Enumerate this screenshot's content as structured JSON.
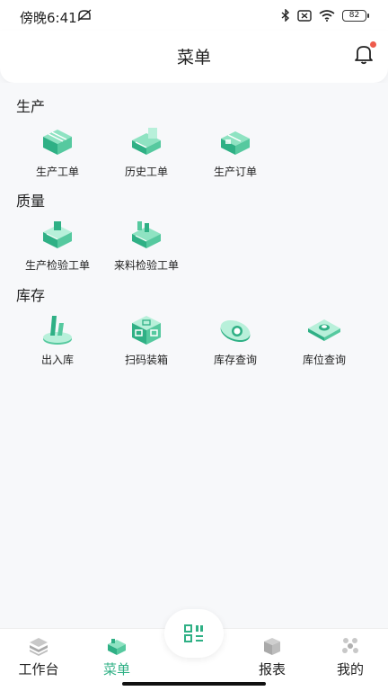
{
  "status": {
    "time": "傍晚6:41",
    "battery": "82"
  },
  "header": {
    "title": "菜单"
  },
  "sections": {
    "production": {
      "title": "生产",
      "items": [
        {
          "label": "生产工单",
          "icon": "production-order-icon"
        },
        {
          "label": "历史工单",
          "icon": "history-order-icon"
        },
        {
          "label": "生产订单",
          "icon": "production-plan-icon"
        }
      ]
    },
    "quality": {
      "title": "质量",
      "items": [
        {
          "label": "生产检验工单",
          "icon": "production-inspection-icon"
        },
        {
          "label": "来料检验工单",
          "icon": "incoming-inspection-icon"
        }
      ]
    },
    "inventory": {
      "title": "库存",
      "items": [
        {
          "label": "出入库",
          "icon": "in-out-stock-icon"
        },
        {
          "label": "扫码装箱",
          "icon": "scan-packing-icon"
        },
        {
          "label": "库存查询",
          "icon": "stock-query-icon"
        },
        {
          "label": "库位查询",
          "icon": "location-query-icon"
        }
      ]
    }
  },
  "tabbar": {
    "items": [
      {
        "label": "工作台"
      },
      {
        "label": "菜单"
      },
      {
        "label": "报表"
      },
      {
        "label": "我的"
      }
    ],
    "active_color": "#2fb085"
  }
}
